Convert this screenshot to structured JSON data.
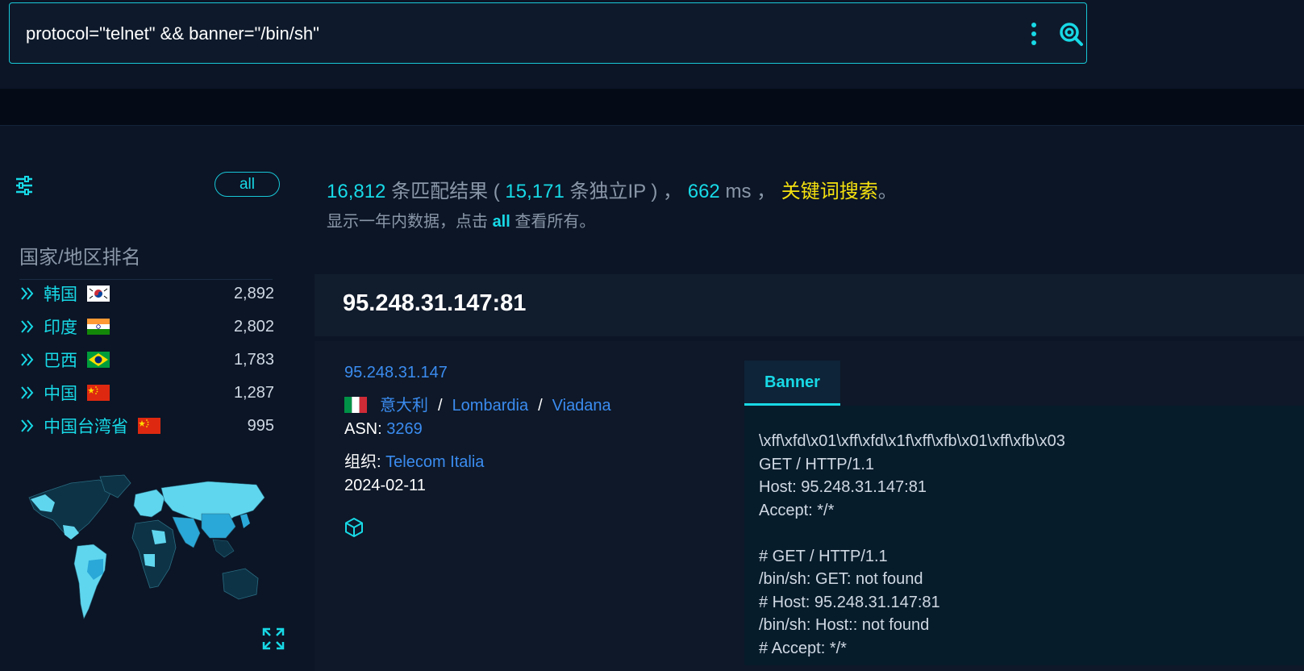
{
  "search": {
    "query": "protocol=\"telnet\" && banner=\"/bin/sh\""
  },
  "sidebar": {
    "all_label": "all",
    "rank_title": "国家/地区排名",
    "countries": [
      {
        "name": "韩国",
        "count": "2,892",
        "flag": "kr"
      },
      {
        "name": "印度",
        "count": "2,802",
        "flag": "in"
      },
      {
        "name": "巴西",
        "count": "1,783",
        "flag": "br"
      },
      {
        "name": "中国",
        "count": "1,287",
        "flag": "cn"
      },
      {
        "name": "中国台湾省",
        "count": "995",
        "flag": "cn"
      }
    ]
  },
  "summary": {
    "total": "16,812",
    "total_suffix": " 条匹配结果 ( ",
    "unique_ip": "15,171",
    "unique_suffix": " 条独立IP ) ，",
    "time": "662",
    "time_suffix": " ms ，",
    "keyword_search": "关键词搜索",
    "end_punct": "。",
    "line2_prefix": "显示一年内数据，点击 ",
    "line2_link": "all",
    "line2_suffix": " 查看所有。"
  },
  "result": {
    "title": "95.248.31.147:81",
    "ip": "95.248.31.147",
    "country": "意大利",
    "region": "Lombardia",
    "city": "Viadana",
    "asn_label": "ASN: ",
    "asn": "3269",
    "org_label": "组织: ",
    "org": "Telecom Italia",
    "date": "2024-02-11",
    "tab_label": "Banner",
    "banner": "\\xff\\xfd\\x01\\xff\\xfd\\x1f\\xff\\xfb\\x01\\xff\\xfb\\x03\nGET / HTTP/1.1\nHost: 95.248.31.147:81\nAccept: */*\n\n# GET / HTTP/1.1\n/bin/sh: GET: not found\n# Host: 95.248.31.147:81\n/bin/sh: Host:: not found\n# Accept: */*"
  },
  "colors": {
    "accent": "#18d9e6",
    "link": "#3b8cf0",
    "highlight": "#f5e10f",
    "background": "#0b1526"
  }
}
